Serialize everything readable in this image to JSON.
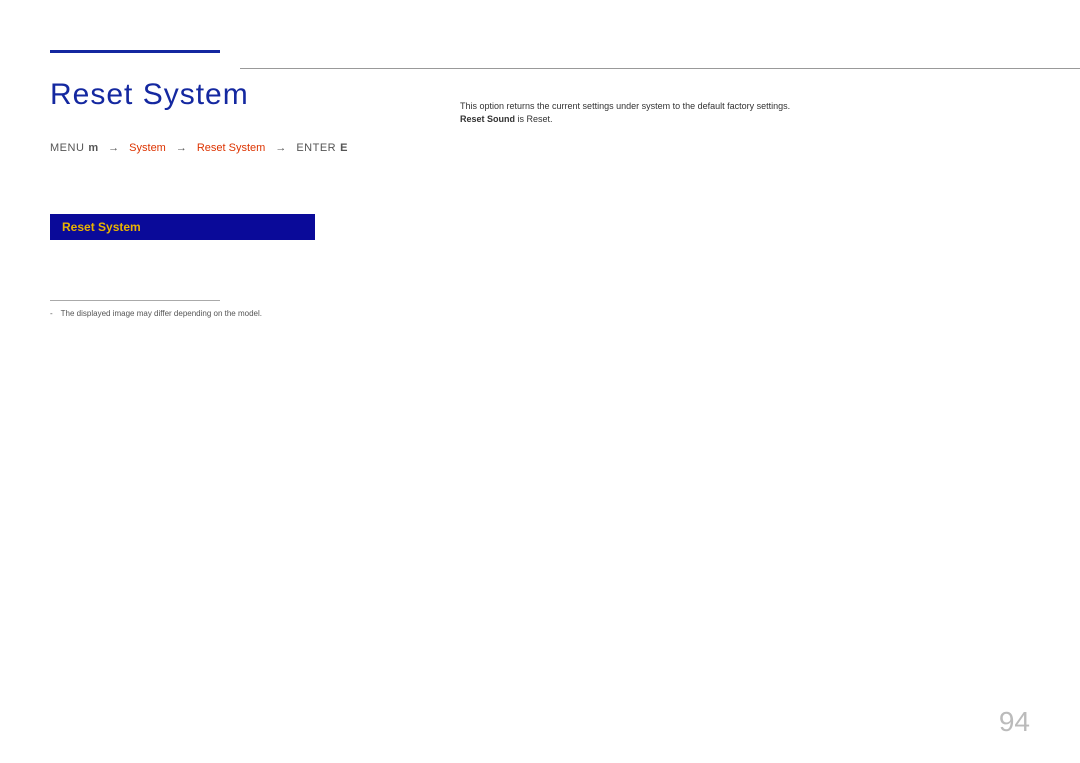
{
  "heading": "Reset System",
  "breadcrumb": {
    "menu": "MENU",
    "menuIcon": "m",
    "arrow": "→",
    "item1": "System",
    "item2": "Reset System",
    "enter": "ENTER",
    "enterIcon": "E"
  },
  "menuPreview": {
    "selected": "Reset System"
  },
  "footnote": {
    "dash": "-",
    "text": "The displayed image may differ depending on the model."
  },
  "description": {
    "line1": "This option returns the current settings under system to the default factory settings.",
    "line2_bold": "Reset Sound",
    "line2_rest": " is Reset."
  },
  "pageNumber": "94"
}
